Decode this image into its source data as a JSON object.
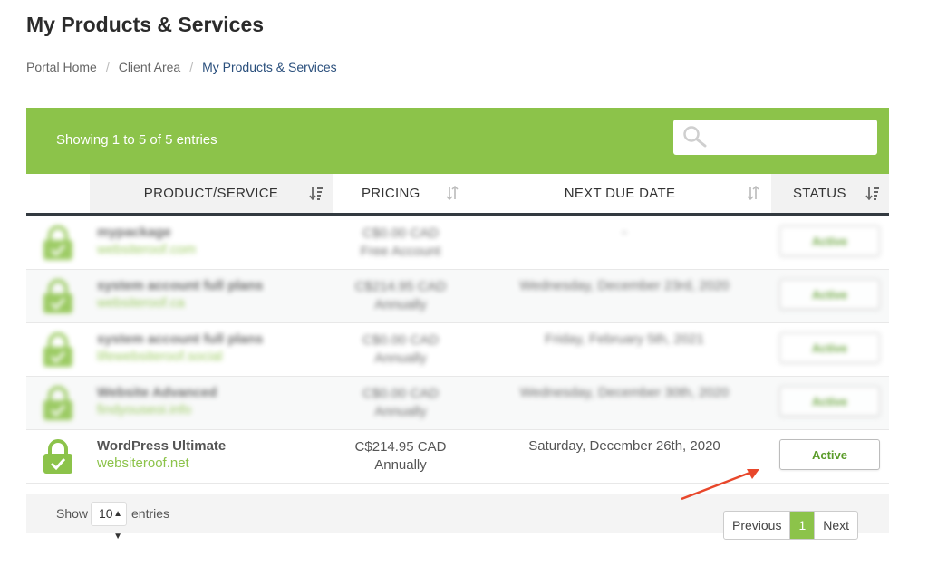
{
  "page": {
    "title": "My Products & Services"
  },
  "breadcrumb": {
    "items": [
      "Portal Home",
      "Client Area"
    ],
    "current": "My Products & Services"
  },
  "table": {
    "info": "Showing 1 to 5 of 5 entries",
    "search": {
      "placeholder": ""
    },
    "columns": {
      "product": "PRODUCT/SERVICE",
      "pricing": "PRICING",
      "due": "NEXT DUE DATE",
      "status": "STATUS"
    },
    "rows": [
      {
        "name": "mypackage",
        "domain": "websiteroof.com",
        "price": "C$0.00 CAD",
        "cycle": "Free Account",
        "due": "-",
        "status": "Active"
      },
      {
        "name": "system account full plans",
        "domain": "websiteroof.ca",
        "price": "C$214.95 CAD",
        "cycle": "Annually",
        "due": "Wednesday, December 23rd, 2020",
        "status": "Active"
      },
      {
        "name": "system account full plans",
        "domain": "lifewebsiteroof.social",
        "price": "C$0.00 CAD",
        "cycle": "Annually",
        "due": "Friday, February 5th, 2021",
        "status": "Active"
      },
      {
        "name": "Website Advanced",
        "domain": "findyouseoi.info",
        "price": "C$0.00 CAD",
        "cycle": "Annually",
        "due": "Wednesday, December 30th, 2020",
        "status": "Active"
      },
      {
        "name": "WordPress Ultimate",
        "domain": "websiteroof.net",
        "price": "C$214.95 CAD",
        "cycle": "Annually",
        "due": "Saturday, December 26th, 2020",
        "status": "Active"
      }
    ]
  },
  "footer": {
    "show_label": "Show",
    "page_size": "10",
    "entries_label": "entries",
    "pagination": {
      "previous": "Previous",
      "current": "1",
      "next": "Next"
    }
  },
  "colors": {
    "accent": "#8cc34a",
    "status_text": "#5b9c2a",
    "annotation_arrow": "#e8472b"
  },
  "icons": {
    "search": "search-icon",
    "lock": "lock-check-icon",
    "sort": "sort-icon",
    "arrow": "annotation-arrow"
  }
}
